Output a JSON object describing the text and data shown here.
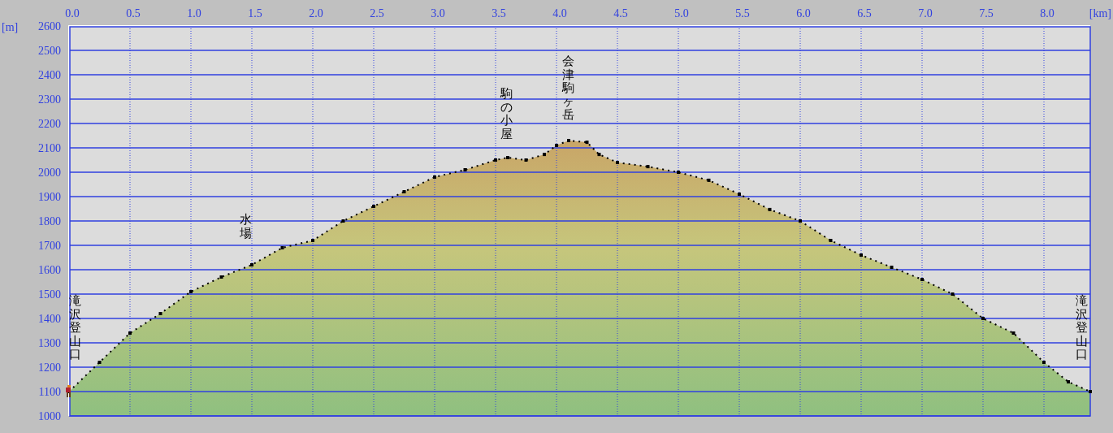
{
  "chart_data": {
    "type": "area",
    "xlabel": "[km]",
    "ylabel": "[m]",
    "x": [
      0,
      0.25,
      0.5,
      0.75,
      1.0,
      1.25,
      1.5,
      1.75,
      2.0,
      2.25,
      2.5,
      2.75,
      3.0,
      3.25,
      3.5,
      3.6,
      3.75,
      3.9,
      4.0,
      4.1,
      4.25,
      4.35,
      4.5,
      4.75,
      5.0,
      5.25,
      5.5,
      5.75,
      6.0,
      6.25,
      6.5,
      6.75,
      7.0,
      7.25,
      7.5,
      7.75,
      8.0,
      8.2,
      8.38
    ],
    "grid": true,
    "series": [
      {
        "color": "#000000",
        "values": [
          1100,
          1220,
          1340,
          1420,
          1510,
          1570,
          1620,
          1690,
          1720,
          1800,
          1860,
          1920,
          1980,
          2010,
          2050,
          2060,
          2050,
          2073,
          2110,
          2130,
          2123,
          2073,
          2040,
          2023,
          2000,
          1967,
          1910,
          1847,
          1800,
          1720,
          1660,
          1610,
          1560,
          1500,
          1400,
          1340,
          1220,
          1140,
          1100
        ]
      }
    ],
    "xlim": [
      0,
      8.38
    ],
    "ylim": [
      1000,
      2600
    ],
    "xticks": [
      {
        "value": 0,
        "label": "0.0"
      },
      {
        "value": 0.5,
        "label": "0.5"
      },
      {
        "value": 1,
        "label": "1.0"
      },
      {
        "value": 1.5,
        "label": "1.5"
      },
      {
        "value": 2,
        "label": "2.0"
      },
      {
        "value": 2.5,
        "label": "2.5"
      },
      {
        "value": 3,
        "label": "3.0"
      },
      {
        "value": 3.5,
        "label": "3.5"
      },
      {
        "value": 4,
        "label": "4.0"
      },
      {
        "value": 4.5,
        "label": "4.5"
      },
      {
        "value": 5,
        "label": "5.0"
      },
      {
        "value": 5.5,
        "label": "5.5"
      },
      {
        "value": 6,
        "label": "6.0"
      },
      {
        "value": 6.5,
        "label": "6.5"
      },
      {
        "value": 7,
        "label": "7.0"
      },
      {
        "value": 7.5,
        "label": "7.5"
      },
      {
        "value": 8,
        "label": "8.0"
      }
    ],
    "yticks": [
      1000,
      1100,
      1200,
      1300,
      1400,
      1500,
      1600,
      1700,
      1800,
      1900,
      2000,
      2100,
      2200,
      2300,
      2400,
      2500,
      2600
    ],
    "annotations": [
      "滝沢登山口",
      "水場",
      "駒の小屋",
      "会津駒ヶ岳",
      "滝沢登山口"
    ]
  }
}
